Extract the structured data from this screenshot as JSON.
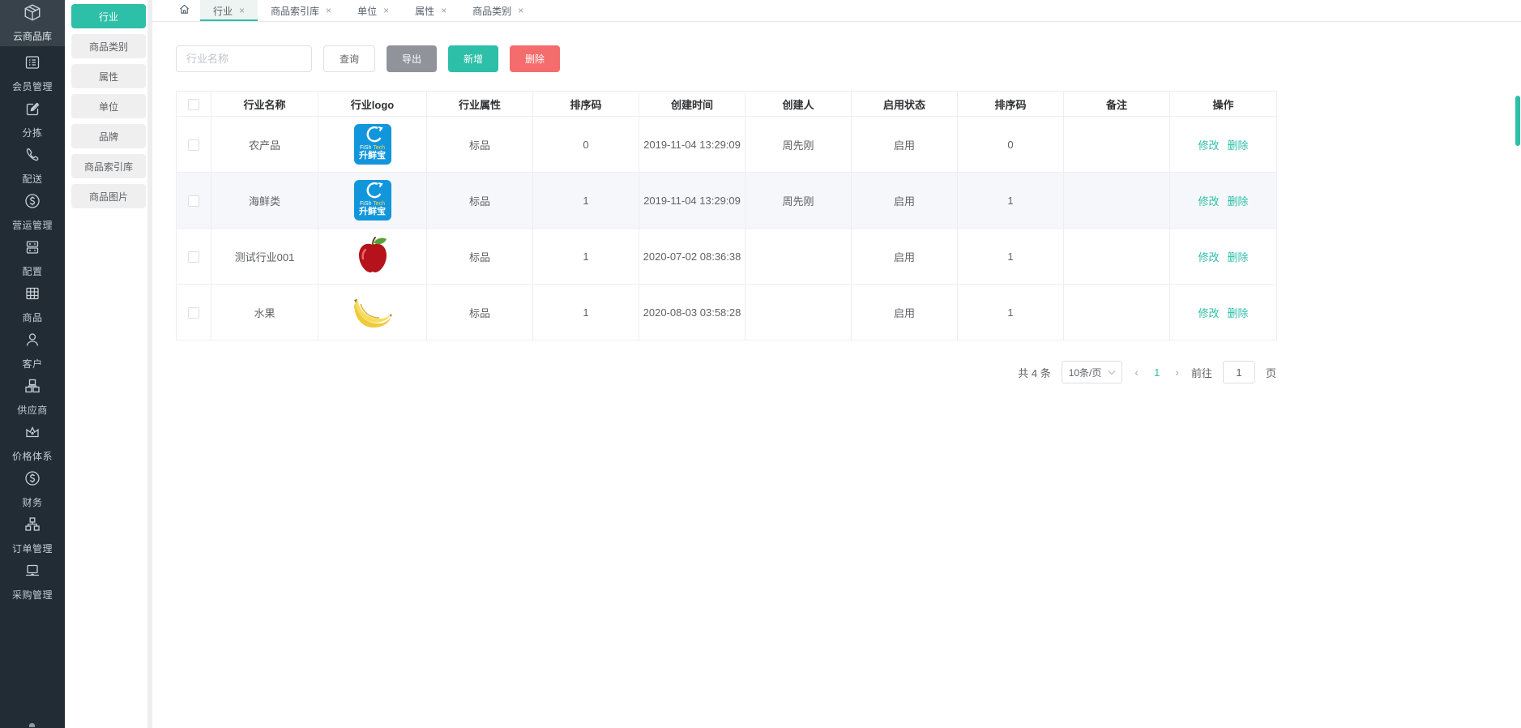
{
  "app": {
    "title": "云商品库",
    "logo_icon": "package-cube-icon"
  },
  "colors": {
    "accent_teal": "#2dbfa7",
    "danger_red": "#f56c6c",
    "info_gray": "#909399",
    "sidebar_dark": "#222c34",
    "logo_blue": "#1296db",
    "stripe_row": "#f5f7fa"
  },
  "sidebar": {
    "items": [
      {
        "label": "会员管理",
        "icon": "member-card-icon"
      },
      {
        "label": "分拣",
        "icon": "edit-square-icon"
      },
      {
        "label": "配送",
        "icon": "phone-icon"
      },
      {
        "label": "营运管理",
        "icon": "dollar-circle-icon"
      },
      {
        "label": "配置",
        "icon": "server-icon"
      },
      {
        "label": "商品",
        "icon": "grid-icon"
      },
      {
        "label": "客户",
        "icon": "user-icon"
      },
      {
        "label": "供应商",
        "icon": "blocks-icon"
      },
      {
        "label": "价格体系",
        "icon": "crown-icon"
      },
      {
        "label": "财务",
        "icon": "dollar-circle-icon"
      },
      {
        "label": "订单管理",
        "icon": "sitemap-icon"
      },
      {
        "label": "采购管理",
        "icon": "laptop-icon"
      }
    ]
  },
  "submenu": {
    "items": [
      {
        "label": "行业",
        "active": true
      },
      {
        "label": "商品类别",
        "active": false
      },
      {
        "label": "属性",
        "active": false
      },
      {
        "label": "单位",
        "active": false
      },
      {
        "label": "品牌",
        "active": false
      },
      {
        "label": "商品索引库",
        "active": false
      },
      {
        "label": "商品图片",
        "active": false
      }
    ]
  },
  "tabs": {
    "close_glyph": "×",
    "items": [
      {
        "label": "行业",
        "active": true
      },
      {
        "label": "商品索引库",
        "active": false
      },
      {
        "label": "单位",
        "active": false
      },
      {
        "label": "属性",
        "active": false
      },
      {
        "label": "商品类别",
        "active": false
      }
    ]
  },
  "toolbar": {
    "name_placeholder": "行业名称",
    "query_label": "查询",
    "export_label": "导出",
    "add_label": "新增",
    "delete_label": "删除"
  },
  "brand_badge": {
    "line1_fish": "FiSh",
    "line1_tech": "Tech",
    "line2": "升鲜宝"
  },
  "table": {
    "headers": [
      "行业名称",
      "行业logo",
      "行业属性",
      "排序码",
      "创建时间",
      "创建人",
      "启用状态",
      "排序码",
      "备注",
      "操作"
    ],
    "edit_label": "修改",
    "delete_label": "删除",
    "rows": [
      {
        "name": "农产品",
        "logo": "fish-tech-logo",
        "attr": "标品",
        "sort": "0",
        "created": "2019-11-04 13:29:09",
        "creator": "周先刚",
        "status": "启用",
        "sort2": "0",
        "remark": ""
      },
      {
        "name": "海鲜类",
        "logo": "fish-tech-logo",
        "attr": "标品",
        "sort": "1",
        "created": "2019-11-04 13:29:09",
        "creator": "周先刚",
        "status": "启用",
        "sort2": "1",
        "remark": ""
      },
      {
        "name": "测试行业001",
        "logo": "apple-image",
        "attr": "标品",
        "sort": "1",
        "created": "2020-07-02 08:36:38",
        "creator": "",
        "status": "启用",
        "sort2": "1",
        "remark": ""
      },
      {
        "name": "水果",
        "logo": "banana-image",
        "attr": "标品",
        "sort": "1",
        "created": "2020-08-03 03:58:28",
        "creator": "",
        "status": "启用",
        "sort2": "1",
        "remark": ""
      }
    ]
  },
  "pagination": {
    "total_text": "共 4 条",
    "page_size_text": "10条/页",
    "prev_glyph": "‹",
    "next_glyph": "›",
    "current_page": "1",
    "goto_label": "前往",
    "goto_value": "1",
    "page_unit": "页"
  }
}
